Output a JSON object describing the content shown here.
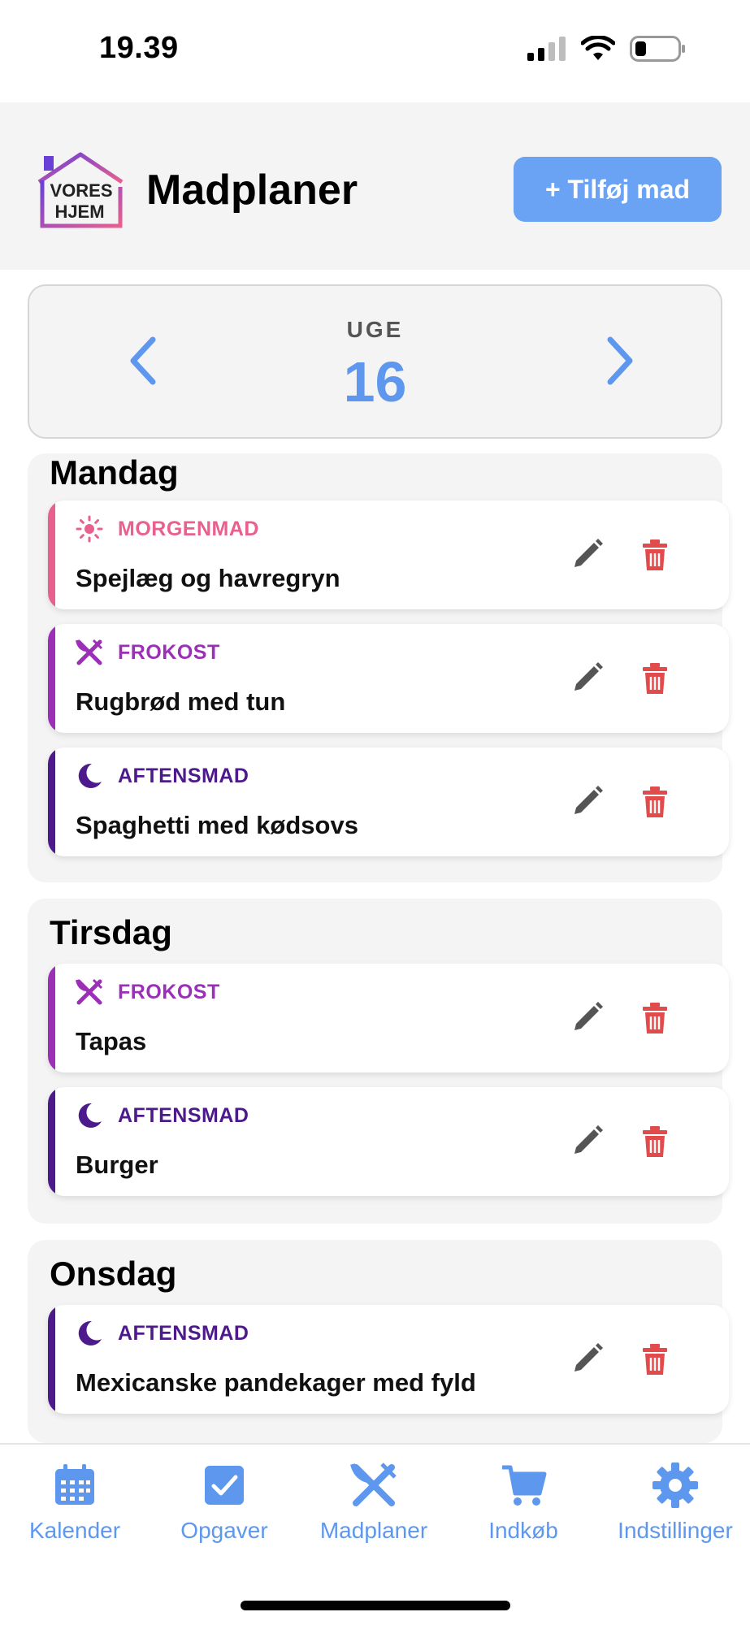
{
  "status": {
    "time": "19.39"
  },
  "header": {
    "logo_text_1": "VORES",
    "logo_text_2": "HJEM",
    "title": "Madplaner",
    "add_button": "+ Tilføj mad"
  },
  "week": {
    "label": "UGE",
    "number": "16"
  },
  "colors": {
    "accent": "#6aa3f4",
    "morgenmad": "#e8608f",
    "frokost": "#9b2fb8",
    "aftensmad": "#4d1a8c",
    "delete": "#e24b4b"
  },
  "days": [
    {
      "name": "Mandag",
      "meals": [
        {
          "category": "MORGENMAD",
          "name": "Spejlæg og havregryn"
        },
        {
          "category": "FROKOST",
          "name": "Rugbrød med tun"
        },
        {
          "category": "AFTENSMAD",
          "name": "Spaghetti med kødsovs"
        }
      ]
    },
    {
      "name": "Tirsdag",
      "meals": [
        {
          "category": "FROKOST",
          "name": "Tapas"
        },
        {
          "category": "AFTENSMAD",
          "name": "Burger"
        }
      ]
    },
    {
      "name": "Onsdag",
      "meals": [
        {
          "category": "AFTENSMAD",
          "name": "Mexicanske pandekager med fyld"
        }
      ]
    }
  ],
  "nav": [
    {
      "label": "Kalender",
      "icon": "calendar-icon"
    },
    {
      "label": "Opgaver",
      "icon": "checkbox-icon"
    },
    {
      "label": "Madplaner",
      "icon": "utensils-icon"
    },
    {
      "label": "Indkøb",
      "icon": "cart-icon"
    },
    {
      "label": "Indstillinger",
      "icon": "gear-icon"
    }
  ]
}
